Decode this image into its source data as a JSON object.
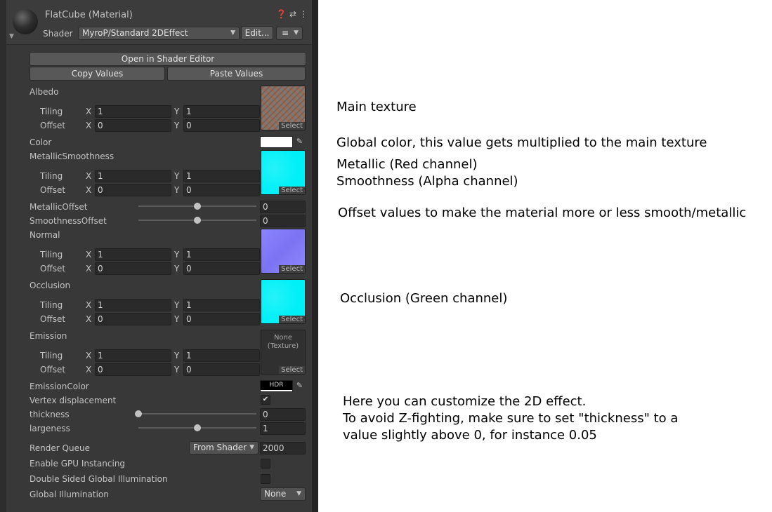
{
  "header": {
    "title": "FlatCube (Material)",
    "shader_label": "Shader",
    "shader_value": "MyroP/Standard 2DEffect",
    "edit_button": "Edit...",
    "icons": [
      "help-icon",
      "preset-icon",
      "more-icon",
      "list-icon"
    ]
  },
  "buttons": {
    "open_shader_editor": "Open in Shader Editor",
    "copy_values": "Copy Values",
    "paste_values": "Paste Values"
  },
  "texture_select": "Select",
  "texture_none": "None\n(Texture)",
  "tiling_label": "Tiling",
  "offset_label": "Offset",
  "x_label": "X",
  "y_label": "Y",
  "properties": {
    "albedo": {
      "label": "Albedo",
      "tiling_x": "1",
      "tiling_y": "1",
      "offset_x": "0",
      "offset_y": "0"
    },
    "color": {
      "label": "Color",
      "value": "#ffffff"
    },
    "metallic_smoothness": {
      "label": "MetallicSmoothness",
      "tiling_x": "1",
      "tiling_y": "1",
      "offset_x": "0",
      "offset_y": "0"
    },
    "metallic_offset": {
      "label": "MetallicOffset",
      "value": "0",
      "fraction": 0.5
    },
    "smoothness_offset": {
      "label": "SmoothnessOffset",
      "value": "0",
      "fraction": 0.5
    },
    "normal": {
      "label": "Normal",
      "tiling_x": "1",
      "tiling_y": "1",
      "offset_x": "0",
      "offset_y": "0"
    },
    "occlusion": {
      "label": "Occlusion",
      "tiling_x": "1",
      "tiling_y": "1",
      "offset_x": "0",
      "offset_y": "0"
    },
    "emission": {
      "label": "Emission",
      "tiling_x": "1",
      "tiling_y": "1",
      "offset_x": "0",
      "offset_y": "0"
    },
    "emission_color": {
      "label": "EmissionColor",
      "hdr": "HDR"
    },
    "vertex_displacement": {
      "label": "Vertex displacement",
      "checked": true
    },
    "thickness": {
      "label": "thickness",
      "value": "0",
      "fraction": 0.0
    },
    "largeness": {
      "label": "largeness",
      "value": "1",
      "fraction": 0.5
    }
  },
  "render_queue": {
    "label": "Render Queue",
    "mode": "From Shader",
    "value": "2000"
  },
  "gpu_instancing": {
    "label": "Enable GPU Instancing",
    "checked": false
  },
  "double_sided_gi": {
    "label": "Double Sided Global Illumination",
    "checked": false
  },
  "global_illumination": {
    "label": "Global Illumination",
    "value": "None"
  },
  "notes": {
    "main_texture": "Main texture",
    "global_color": "Global color, this value gets multiplied to the main texture",
    "metallic": "Metallic (Red channel)",
    "smoothness": "Smoothness (Alpha channel)",
    "offset": "Offset values to make the material more or less smooth/metallic",
    "occlusion": "Occlusion (Green channel)",
    "effect_1": "Here you can customize the 2D effect.",
    "effect_2": "To avoid Z-fighting, make sure to set \"thickness\" to a",
    "effect_3": "value slightly above 0, for instance 0.05"
  },
  "colors": {
    "panel_bg": "#383838",
    "field_bg": "#2a2a2a",
    "cyan_texture": "#00f0f8",
    "normal_texture": "#8a84ff"
  }
}
